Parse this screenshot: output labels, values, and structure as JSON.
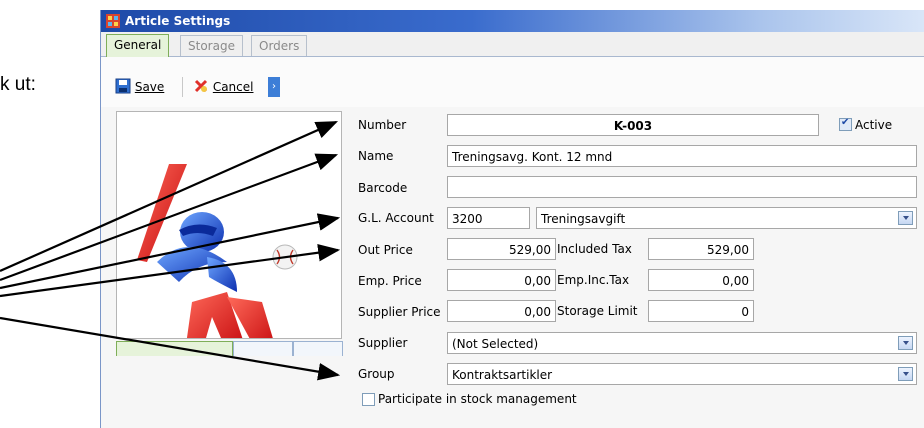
{
  "document": {
    "text": "k ut:"
  },
  "window": {
    "title": "Article Settings"
  },
  "tabs": [
    {
      "label": "General",
      "active": true
    },
    {
      "label": "Storage",
      "active": false
    },
    {
      "label": "Orders",
      "active": false
    }
  ],
  "toolbar": {
    "save_label": "Save",
    "cancel_label": "Cancel"
  },
  "form": {
    "number_label": "Number",
    "number_value": "K-003",
    "active_label": "Active",
    "active_checked": true,
    "name_label": "Name",
    "name_value": "Treningsavg. Kont. 12 mnd",
    "barcode_label": "Barcode",
    "barcode_value": "",
    "gl_label": "G.L. Account",
    "gl_code": "3200",
    "gl_name": "Treningsavgift",
    "out_price_label": "Out Price",
    "out_price_value": "529,00",
    "included_tax_label": "Included Tax",
    "included_tax_value": "529,00",
    "emp_price_label": "Emp. Price",
    "emp_price_value": "0,00",
    "emp_inc_tax_label": "Emp.Inc.Tax",
    "emp_inc_tax_value": "0,00",
    "supplier_price_label": "Supplier Price",
    "supplier_price_value": "0,00",
    "storage_limit_label": "Storage Limit",
    "storage_limit_value": "0",
    "supplier_label": "Supplier",
    "supplier_value": "(Not Selected)",
    "group_label": "Group",
    "group_value": "Kontraktsartikler",
    "stock_label": "Participate in stock management",
    "stock_checked": false
  },
  "colors": {
    "title_gradient_start": "#1e4aa8",
    "active_tab": "#e6f3da",
    "arrow": "#000000"
  },
  "icons": [
    "app-icon",
    "save-icon",
    "cancel-icon",
    "chevron-right-icon",
    "dropdown-arrow-icon",
    "checkbox-icon"
  ]
}
